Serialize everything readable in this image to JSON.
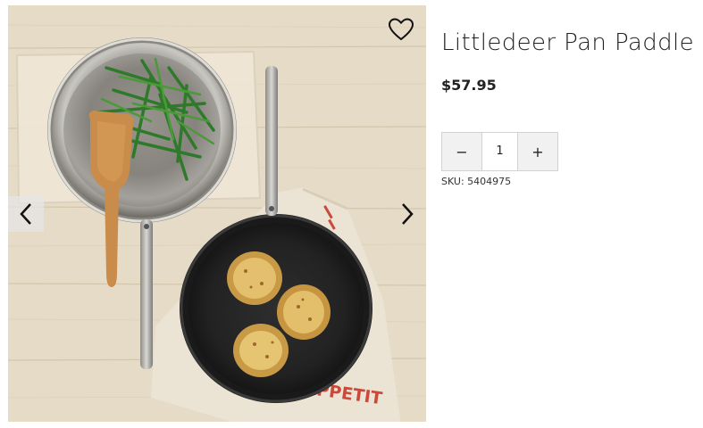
{
  "product": {
    "title": "Littledeer Pan Paddle",
    "price": "$57.95",
    "sku_label": "SKU:",
    "sku_value": "5404975",
    "image_alt": "Littledeer Pan Paddle"
  },
  "quantity": {
    "decrement_label": "−",
    "value": "1",
    "increment_label": "+"
  },
  "gallery": {
    "towel_print": "APPETIT",
    "icons": {
      "wishlist": "heart-outline-icon",
      "prev": "chevron-left-icon",
      "next": "chevron-right-icon"
    }
  },
  "colors": {
    "text": "#222222",
    "border": "#d2d2d2",
    "button_bg": "#f1f1f1",
    "wood": "#e8ddc9",
    "towel_stripe": "#c94a3a"
  }
}
